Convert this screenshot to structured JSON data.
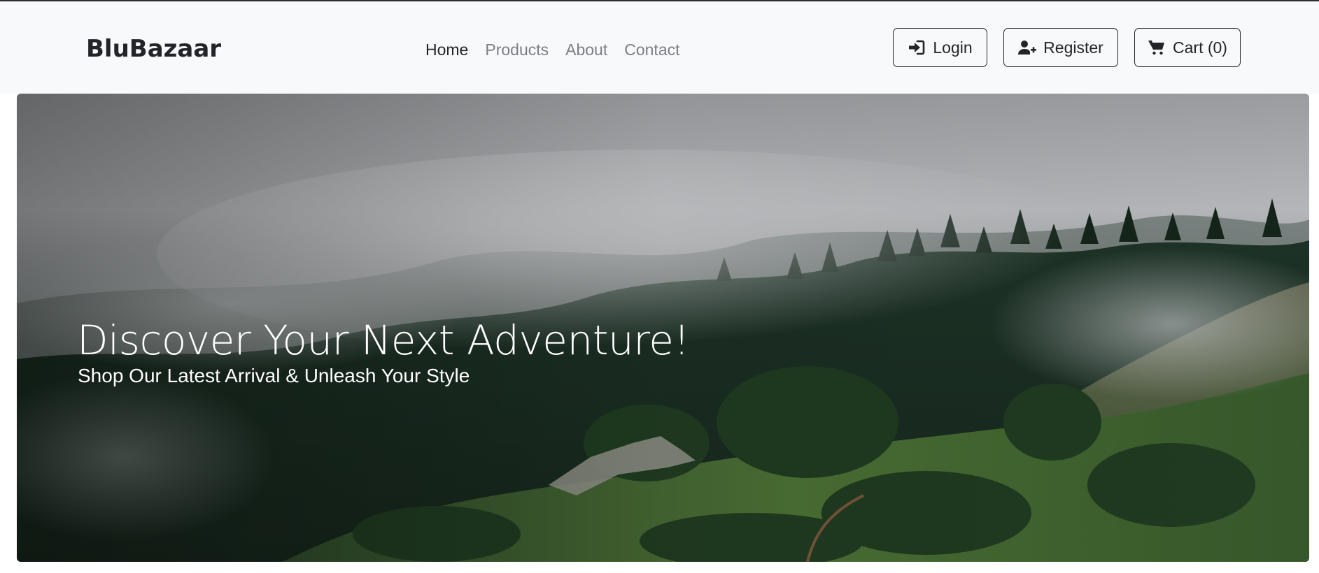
{
  "brand": {
    "name": "BluBazaar"
  },
  "nav": {
    "items": [
      {
        "label": "Home",
        "active": true
      },
      {
        "label": "Products",
        "active": false
      },
      {
        "label": "About",
        "active": false
      },
      {
        "label": "Contact",
        "active": false
      }
    ]
  },
  "actions": {
    "login_label": "Login",
    "login_icon": "sign-in-icon",
    "register_label": "Register",
    "register_icon": "user-plus-icon",
    "cart_label": "Cart (0)",
    "cart_icon": "shopping-cart-icon"
  },
  "hero": {
    "title": "Discover Your Next Adventure!",
    "subtitle": "Shop Our Latest Arrival & Unleash Your Style",
    "image": "misty-forested-hillside"
  },
  "colors": {
    "navbar_bg": "#f8f9fa",
    "text_dark": "#212529",
    "text_muted": "#7a7f85",
    "hero_text": "#ffffff"
  }
}
